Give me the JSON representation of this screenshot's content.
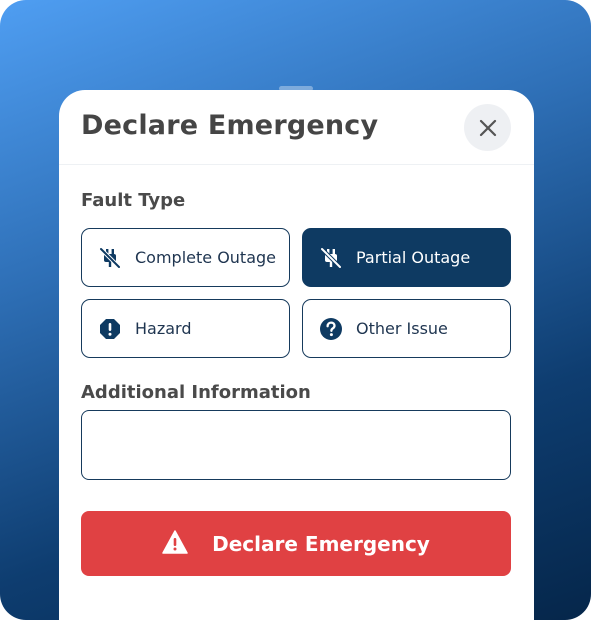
{
  "modal": {
    "title": "Declare Emergency",
    "close_icon": "close-icon"
  },
  "fault_type": {
    "label": "Fault Type",
    "options": [
      {
        "label": "Complete Outage",
        "icon": "unplugged-icon",
        "selected": false
      },
      {
        "label": "Partial Outage",
        "icon": "unplugged-icon",
        "selected": true
      },
      {
        "label": "Hazard",
        "icon": "alert-octagon-icon",
        "selected": false
      },
      {
        "label": "Other Issue",
        "icon": "question-circle-icon",
        "selected": false
      }
    ]
  },
  "additional_info": {
    "label": "Additional Information",
    "value": "",
    "placeholder": ""
  },
  "submit": {
    "label": "Declare Emergency",
    "icon": "warning-triangle-icon",
    "color": "#e04143"
  },
  "colors": {
    "primary": "#0e3a62",
    "border": "#163a5c",
    "danger": "#e04143",
    "background_gradient_start": "#4f9ef2",
    "background_gradient_end": "#05264a"
  }
}
